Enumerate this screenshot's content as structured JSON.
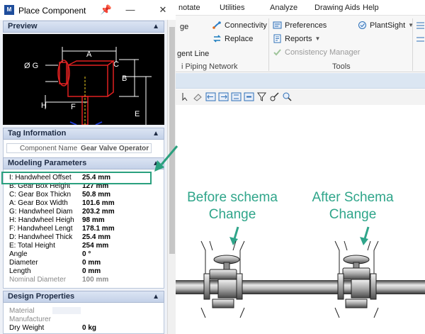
{
  "host_app": {
    "menu": [
      "notate",
      "Utilities",
      "Analyze",
      "Drawing Aids",
      "Help"
    ],
    "ribbon": {
      "connectivity_label": "Connectivity",
      "replace_label": "Replace",
      "ge_label": "ge",
      "gent_line_label": "gent Line",
      "preferences_label": "Preferences",
      "reports_label": "Reports",
      "consistency_label": "Consistency Manager",
      "plantsight_label": "PlantSight",
      "group_piping_label": "i Piping Network",
      "group_tools_label": "Tools"
    },
    "drawing": {
      "before_caption_line1": "Before schema",
      "before_caption_line2": "Change",
      "after_caption_line1": "After Schema",
      "after_caption_line2": "Change",
      "caption_color": "#2fa58a"
    }
  },
  "panel": {
    "title": "Place Component",
    "logo_text": "M",
    "sections": {
      "preview": "Preview",
      "tag": "Tag Information",
      "modeling": "Modeling Parameters",
      "design": "Design Properties"
    },
    "tag_info": {
      "label": "Component Name",
      "value": "Gear Valve Operator"
    },
    "modeling_params": [
      {
        "label": "I: Handwheel Offset",
        "value": "25.4 mm"
      },
      {
        "label": "B: Gear Box Height",
        "value": "127 mm"
      },
      {
        "label": "C: Gear Box Thickn",
        "value": "50.8 mm"
      },
      {
        "label": "A: Gear Box Width",
        "value": "101.6 mm"
      },
      {
        "label": "G: Handwheel Diam",
        "value": "203.2 mm"
      },
      {
        "label": "H: Handwheel Heigh",
        "value": "98 mm"
      },
      {
        "label": "F: Handwheel Lengt",
        "value": "178.1 mm"
      },
      {
        "label": "D: Handwheel Thick",
        "value": "25.4 mm"
      },
      {
        "label": "E: Total Height",
        "value": "254 mm"
      },
      {
        "label": "Angle",
        "value": "0 °"
      },
      {
        "label": "Diameter",
        "value": "0 mm"
      },
      {
        "label": "Length",
        "value": "0 mm"
      },
      {
        "label": "Nominal Diameter",
        "value": "100 mm"
      }
    ],
    "design_props": [
      {
        "label": "Material",
        "value": ""
      },
      {
        "label": "Manufacturer",
        "value": ""
      },
      {
        "label": "Dry Weight",
        "value": "0 kg"
      }
    ],
    "preview_dims": {
      "a": "A",
      "b": "B",
      "c": "C",
      "e": "E",
      "f": "F",
      "g": "Ø G",
      "h": "H"
    },
    "highlight_color": "#2aa07e"
  }
}
